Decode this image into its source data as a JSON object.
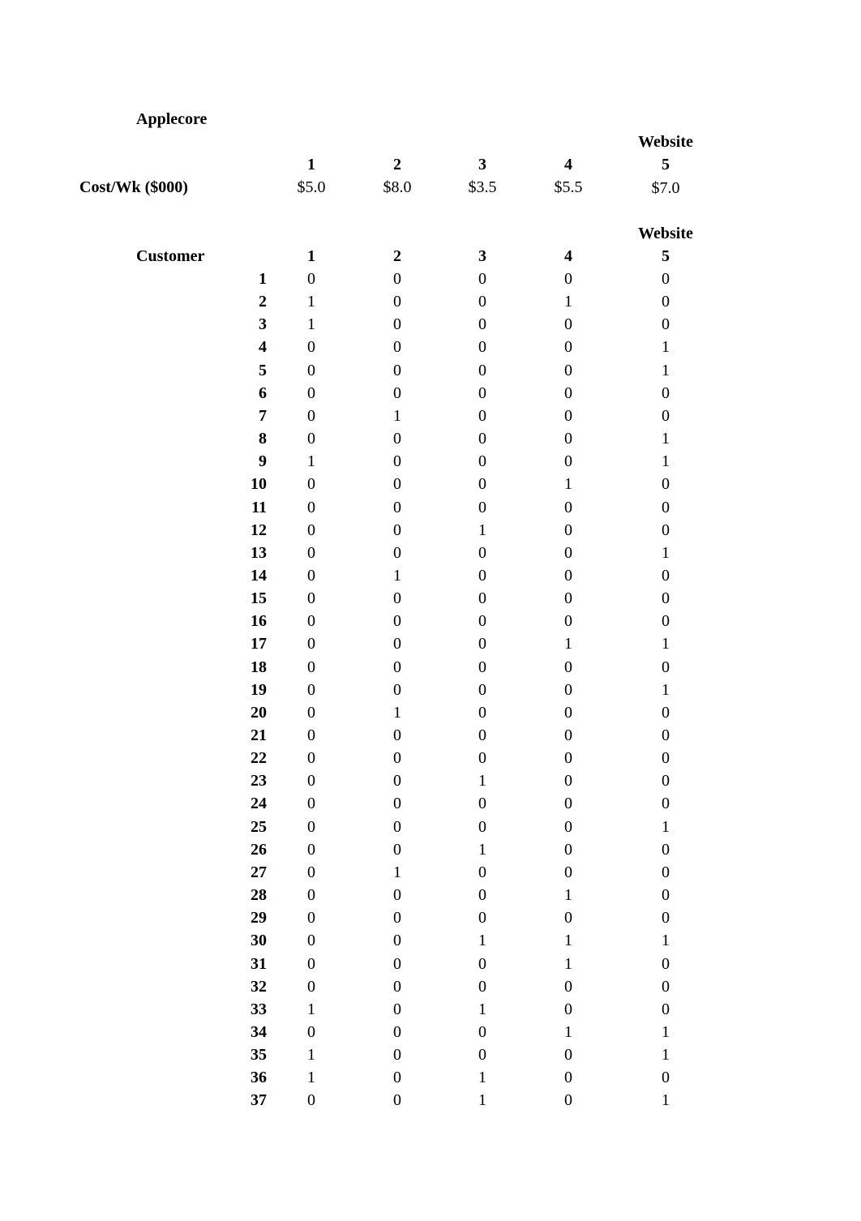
{
  "company": "Applecore",
  "cost_section": {
    "row_label": "Cost/Wk ($000)",
    "website_header": "Website",
    "website_numbers": [
      "1",
      "2",
      "3",
      "4",
      "5"
    ],
    "costs": [
      "$5.0",
      "$8.0",
      "$3.5",
      "$5.5",
      "$7.0"
    ]
  },
  "customer_section": {
    "row_label": "Customer",
    "website_header": "Website",
    "website_numbers": [
      "1",
      "2",
      "3",
      "4",
      "5"
    ],
    "rows": [
      {
        "customer": "1",
        "values": [
          0,
          0,
          0,
          0,
          0
        ]
      },
      {
        "customer": "2",
        "values": [
          1,
          0,
          0,
          1,
          0
        ]
      },
      {
        "customer": "3",
        "values": [
          1,
          0,
          0,
          0,
          0
        ]
      },
      {
        "customer": "4",
        "values": [
          0,
          0,
          0,
          0,
          1
        ]
      },
      {
        "customer": "5",
        "values": [
          0,
          0,
          0,
          0,
          1
        ]
      },
      {
        "customer": "6",
        "values": [
          0,
          0,
          0,
          0,
          0
        ]
      },
      {
        "customer": "7",
        "values": [
          0,
          1,
          0,
          0,
          0
        ]
      },
      {
        "customer": "8",
        "values": [
          0,
          0,
          0,
          0,
          1
        ]
      },
      {
        "customer": "9",
        "values": [
          1,
          0,
          0,
          0,
          1
        ]
      },
      {
        "customer": "10",
        "values": [
          0,
          0,
          0,
          1,
          0
        ]
      },
      {
        "customer": "11",
        "values": [
          0,
          0,
          0,
          0,
          0
        ]
      },
      {
        "customer": "12",
        "values": [
          0,
          0,
          1,
          0,
          0
        ]
      },
      {
        "customer": "13",
        "values": [
          0,
          0,
          0,
          0,
          1
        ]
      },
      {
        "customer": "14",
        "values": [
          0,
          1,
          0,
          0,
          0
        ]
      },
      {
        "customer": "15",
        "values": [
          0,
          0,
          0,
          0,
          0
        ]
      },
      {
        "customer": "16",
        "values": [
          0,
          0,
          0,
          0,
          0
        ]
      },
      {
        "customer": "17",
        "values": [
          0,
          0,
          0,
          1,
          1
        ]
      },
      {
        "customer": "18",
        "values": [
          0,
          0,
          0,
          0,
          0
        ]
      },
      {
        "customer": "19",
        "values": [
          0,
          0,
          0,
          0,
          1
        ]
      },
      {
        "customer": "20",
        "values": [
          0,
          1,
          0,
          0,
          0
        ]
      },
      {
        "customer": "21",
        "values": [
          0,
          0,
          0,
          0,
          0
        ]
      },
      {
        "customer": "22",
        "values": [
          0,
          0,
          0,
          0,
          0
        ]
      },
      {
        "customer": "23",
        "values": [
          0,
          0,
          1,
          0,
          0
        ]
      },
      {
        "customer": "24",
        "values": [
          0,
          0,
          0,
          0,
          0
        ]
      },
      {
        "customer": "25",
        "values": [
          0,
          0,
          0,
          0,
          1
        ]
      },
      {
        "customer": "26",
        "values": [
          0,
          0,
          1,
          0,
          0
        ]
      },
      {
        "customer": "27",
        "values": [
          0,
          1,
          0,
          0,
          0
        ]
      },
      {
        "customer": "28",
        "values": [
          0,
          0,
          0,
          1,
          0
        ]
      },
      {
        "customer": "29",
        "values": [
          0,
          0,
          0,
          0,
          0
        ]
      },
      {
        "customer": "30",
        "values": [
          0,
          0,
          1,
          1,
          1
        ]
      },
      {
        "customer": "31",
        "values": [
          0,
          0,
          0,
          1,
          0
        ]
      },
      {
        "customer": "32",
        "values": [
          0,
          0,
          0,
          0,
          0
        ]
      },
      {
        "customer": "33",
        "values": [
          1,
          0,
          1,
          0,
          0
        ]
      },
      {
        "customer": "34",
        "values": [
          0,
          0,
          0,
          1,
          1
        ]
      },
      {
        "customer": "35",
        "values": [
          1,
          0,
          0,
          0,
          1
        ]
      },
      {
        "customer": "36",
        "values": [
          1,
          0,
          1,
          0,
          0
        ]
      },
      {
        "customer": "37",
        "values": [
          0,
          0,
          1,
          0,
          1
        ]
      }
    ]
  }
}
